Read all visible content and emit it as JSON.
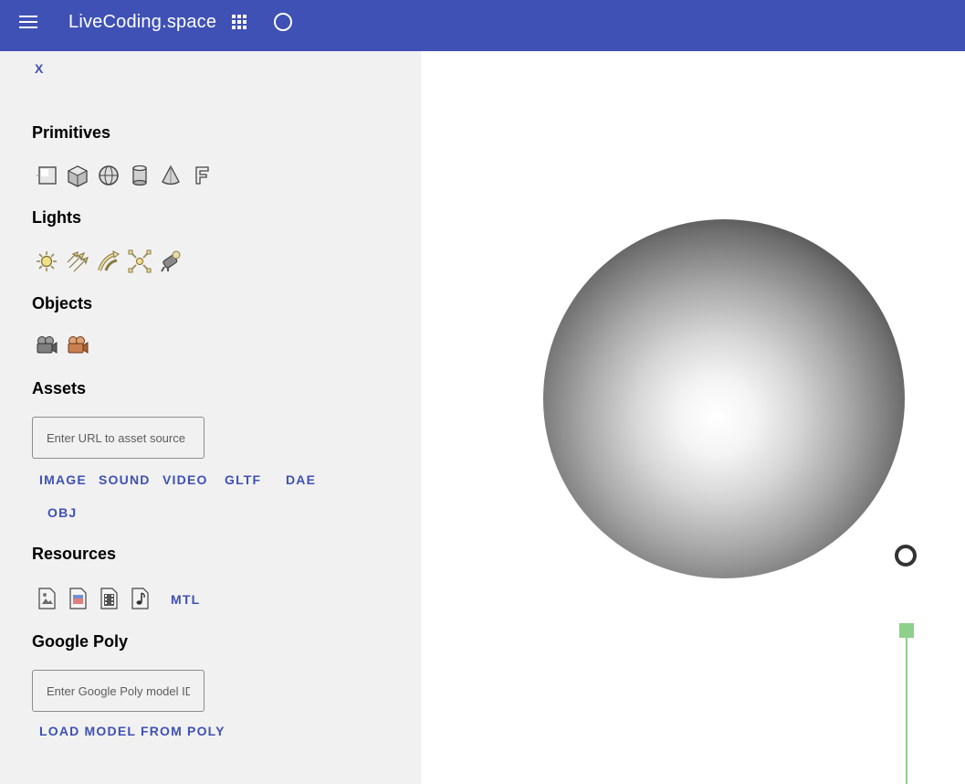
{
  "app": {
    "title": "LiveCoding.space",
    "menu_icon": "hamburger-menu-icon",
    "apps_icon": "apps-grid-icon",
    "circle_icon": "circle-icon"
  },
  "sidebar": {
    "close_label": "X",
    "primitives": {
      "title": "Primitives",
      "items": [
        "plane-icon",
        "cube-icon",
        "sphere-icon",
        "cylinder-icon",
        "cone-icon",
        "text-icon"
      ]
    },
    "lights": {
      "title": "Lights",
      "items": [
        "sun-light-icon",
        "directional-light-icon",
        "spot-light-icon",
        "point-light-icon",
        "camera-light-icon"
      ]
    },
    "objects": {
      "title": "Objects",
      "items": [
        "camera-object-icon",
        "avatar-camera-icon"
      ]
    },
    "assets": {
      "title": "Assets",
      "input_placeholder": "Enter URL to asset source",
      "buttons": [
        "IMAGE",
        "SOUND",
        "VIDEO",
        "GLTF",
        "DAE",
        "OBJ"
      ]
    },
    "resources": {
      "title": "Resources",
      "items": [
        "image-file-icon",
        "picture-file-icon",
        "video-file-icon",
        "audio-file-icon"
      ],
      "mtl_label": "MTL"
    },
    "google_poly": {
      "title": "Google Poly",
      "input_placeholder": "Enter Google Poly model ID",
      "load_button": "LOAD MODEL FROM POLY"
    }
  },
  "colors": {
    "accent": "#3f51b5",
    "sidebar_bg": "#f1f1f1",
    "gizmo_green": "#8cd08c"
  }
}
